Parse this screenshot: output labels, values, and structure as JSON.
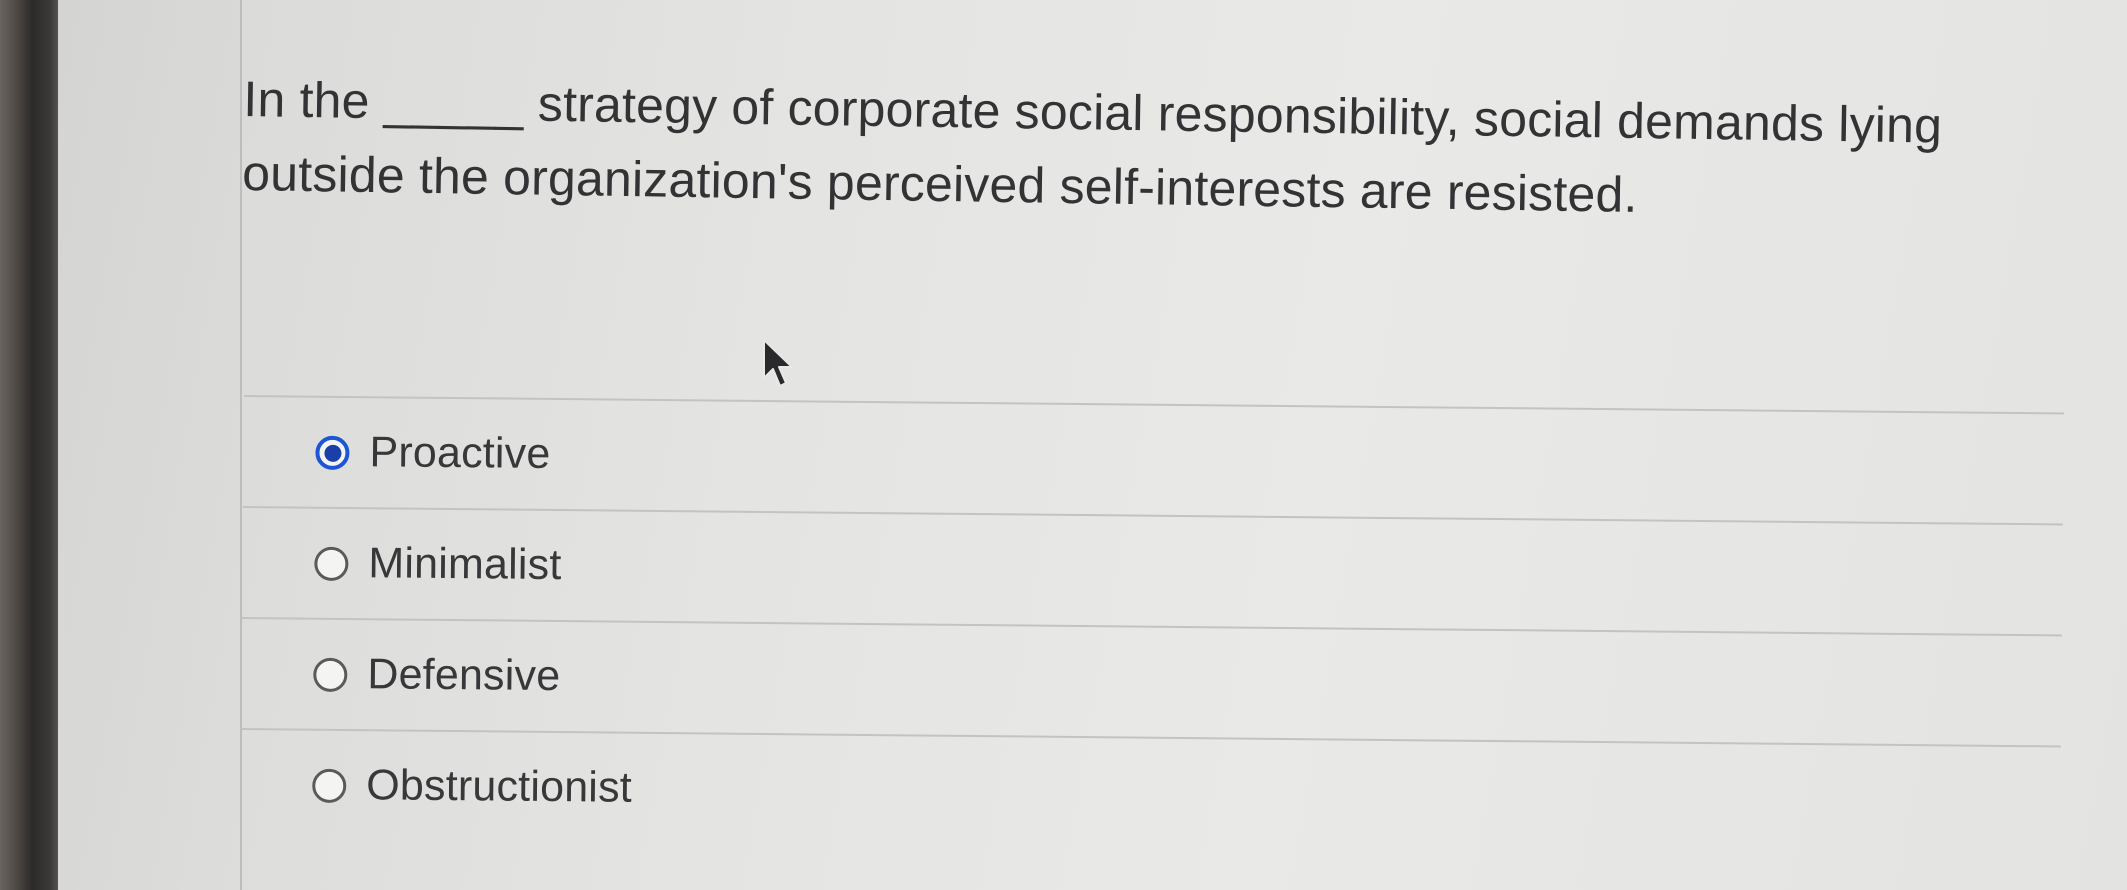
{
  "question": {
    "text": "In the _____ strategy of corporate social responsibility, social demands lying outside the organization's perceived self-interests are resisted."
  },
  "answers": [
    {
      "label": "Proactive",
      "selected": true
    },
    {
      "label": "Minimalist",
      "selected": false
    },
    {
      "label": "Defensive",
      "selected": false
    },
    {
      "label": "Obstructionist",
      "selected": false
    }
  ],
  "colors": {
    "accent": "#1c56d6",
    "text": "#333335",
    "separator": "#c3c3c1"
  },
  "icons": {
    "cursor": "mouse-pointer-icon",
    "radio_checked": "radio-checked-icon",
    "radio_unchecked": "radio-unchecked-icon"
  }
}
